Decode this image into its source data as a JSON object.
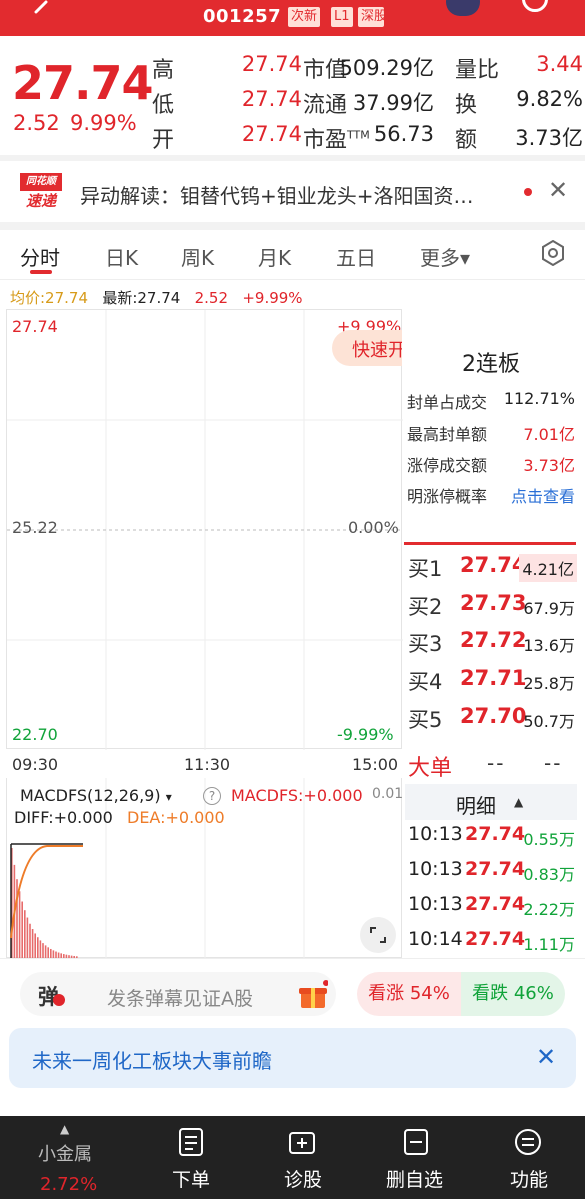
{
  "header": {
    "code": "001257",
    "tags": [
      "次新",
      "L1",
      "深股"
    ]
  },
  "quote": {
    "price": "27.74",
    "change": "2.52",
    "change_pct": "9.99%",
    "stats": [
      {
        "label": "高",
        "value": "27.74",
        "color": "#e0252b"
      },
      {
        "label": "低",
        "value": "27.74",
        "color": "#e0252b"
      },
      {
        "label": "开",
        "value": "27.74",
        "color": "#e0252b"
      },
      {
        "label": "市值",
        "value": "509.29亿",
        "color": "#222222"
      },
      {
        "label": "流通",
        "value": "37.99亿",
        "color": "#222222"
      },
      {
        "label": "市盈TTM",
        "value": "56.73",
        "color": "#222222"
      },
      {
        "label": "量比",
        "value": "3.44",
        "color": "#e0252b"
      },
      {
        "label": "换",
        "value": "9.82%",
        "color": "#222222"
      },
      {
        "label": "额",
        "value": "3.73亿",
        "color": "#222222"
      }
    ]
  },
  "news": {
    "logo_top": "同花顺",
    "logo_bottom": "速递",
    "text": "异动解读：钼替代钨+钼业龙头+洛阳国资…"
  },
  "tabs": [
    "分时",
    "日K",
    "周K",
    "月K",
    "五日",
    "更多▾"
  ],
  "info_line": {
    "avg_label": "均价:27.74",
    "latest_label": "最新:27.74",
    "change": "2.52",
    "pct": "+9.99%"
  },
  "chart": {
    "y_top": "27.74",
    "y_mid": "25.22",
    "y_bottom": "22.70",
    "pct_top": "+9.99%",
    "pct_mid": "0.00%",
    "pct_bottom": "-9.99%",
    "times": [
      "09:30",
      "11:30",
      "15:00"
    ],
    "quick_trade": "快速开"
  },
  "board": {
    "lianban": "2连板",
    "stats": [
      {
        "label": "封单占成交",
        "value": "112.71%",
        "color": "#222222"
      },
      {
        "label": "最高封单额",
        "value": "7.01亿",
        "color": "#e0252b"
      },
      {
        "label": "涨停成交额",
        "value": "3.73亿",
        "color": "#e0252b"
      },
      {
        "label": "明涨停概率",
        "value": "点击查看",
        "color": "#2a6fd6"
      }
    ]
  },
  "orderbook": [
    {
      "label": "买1",
      "price": "27.74",
      "vol": "4.21亿"
    },
    {
      "label": "买2",
      "price": "27.73",
      "vol": "67.9万"
    },
    {
      "label": "买3",
      "price": "27.72",
      "vol": "13.6万"
    },
    {
      "label": "买4",
      "price": "27.71",
      "vol": "25.8万"
    },
    {
      "label": "买5",
      "price": "27.70",
      "vol": "50.7万"
    }
  ],
  "dadan": {
    "label": "大单",
    "v1": "--",
    "v2": "--"
  },
  "mingxi": {
    "label": "明细",
    "arrow": "▲"
  },
  "trades": [
    {
      "time": "10:13",
      "price": "27.74",
      "vol": "0.55万"
    },
    {
      "time": "10:13",
      "price": "27.74",
      "vol": "0.83万"
    },
    {
      "time": "10:13",
      "price": "27.74",
      "vol": "2.22万"
    },
    {
      "time": "10:14",
      "price": "27.74",
      "vol": "1.11万"
    }
  ],
  "macd": {
    "title": "MACDFS(12,26,9)",
    "caret": "▾",
    "help": "?",
    "value": "MACDFS:+0.000",
    "diff": "DIFF:+0.000",
    "dea": "DEA:+0.000",
    "axis": "0.01"
  },
  "danmu": {
    "icon": "弹",
    "placeholder": "发条弹幕见证A股",
    "kanzhang": "看涨 54%",
    "kandie": "看跌 46%"
  },
  "notice": {
    "text": "未来一周化工板块大事前瞻",
    "close": "✕"
  },
  "bottom": {
    "sector_name": "小金属",
    "sector_chg": "2.72%",
    "items": [
      "下单",
      "诊股",
      "删自选",
      "功能"
    ]
  }
}
